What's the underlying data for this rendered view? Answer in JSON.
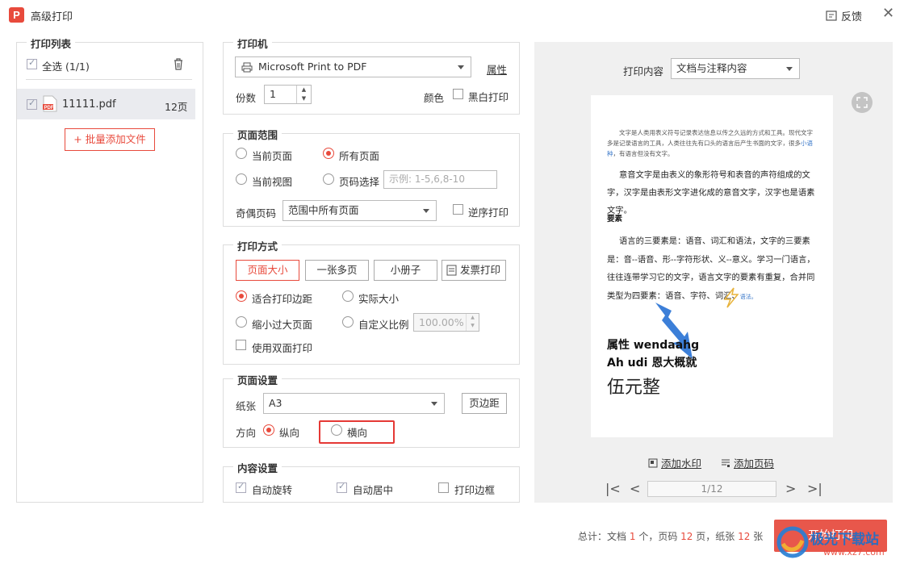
{
  "app": {
    "title": "高级打印",
    "feedback": "反馈"
  },
  "left": {
    "title": "打印列表",
    "select_all": "全选 (1/1)",
    "file_name": "11111.pdf",
    "file_pages": "12页",
    "add_files": "+ 批量添加文件"
  },
  "printer": {
    "title": "打印机",
    "name": "Microsoft Print to PDF",
    "props": "属性",
    "copies_label": "份数",
    "copies": "1",
    "color_label": "颜色",
    "bw": "黑白打印"
  },
  "range": {
    "title": "页面范围",
    "current_page": "当前页面",
    "all_pages": "所有页面",
    "current_view": "当前视图",
    "page_select": "页码选择",
    "page_placeholder": "示例: 1-5,6,8-10",
    "odd_even_label": "奇偶页码",
    "odd_even_value": "范围中所有页面",
    "reverse": "逆序打印"
  },
  "mode": {
    "title": "打印方式",
    "tabs": [
      "页面大小",
      "一张多页",
      "小册子",
      "发票打印"
    ],
    "fit": "适合打印边距",
    "actual": "实际大小",
    "shrink": "缩小过大页面",
    "custom": "自定义比例",
    "scale": "100.00%",
    "duplex": "使用双面打印"
  },
  "page_setup": {
    "title": "页面设置",
    "paper_label": "纸张",
    "paper": "A3",
    "margins": "页边距",
    "orient_label": "方向",
    "portrait": "纵向",
    "landscape": "横向"
  },
  "content": {
    "title": "内容设置",
    "auto_rotate": "自动旋转",
    "auto_center": "自动居中",
    "print_border": "打印边框"
  },
  "preview": {
    "content_label": "打印内容",
    "content_value": "文档与注释内容",
    "watermark": "添加水印",
    "page_number": "添加页码",
    "page_indicator": "1/12",
    "doc": {
      "p1a": "文字是人类用表义符号记录表达信息以传之久远的方式和工具。现代文字多是记录语言的工具，人类往往先有口头的语言后产生书面的文字，很多",
      "p1link": "小语种",
      "p1b": "，有语言但没有文字。",
      "p2": "意音文字是由表义的象形符号和表音的声符组成的文字，汉字是由表形文字进化成的意音文字，汉字也是语素文字。",
      "heading": "要素",
      "p3": "语言的三要素是：语音、词汇和语法，文字的三要素是：音--语音、形--字符形状、义--意义。学习一门语言，往往连带学习它的文字，语言文字的要素有重复，合并同类型为四要素：语音、字符、词汇、",
      "p3link": "语法。",
      "big1": "属性 wendaahg",
      "big2": "Ah udi 恩大概就",
      "big3": "伍元整"
    }
  },
  "footer": {
    "prefix": "总计：文档",
    "docs": "1",
    "mid1": "个，页码",
    "pages": "12",
    "mid2": "页，纸张",
    "sheets": "12",
    "suffix": "张",
    "start": "开始打印"
  },
  "watermark_logo": "极光下载站",
  "watermark_url": "www.xz7.com"
}
